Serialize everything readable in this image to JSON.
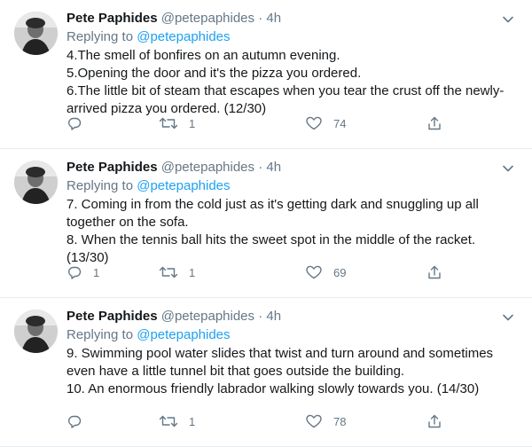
{
  "tweets": [
    {
      "name": "Pete Paphides",
      "handle": "@petepaphides",
      "time": "4h",
      "replying_prefix": "Replying to",
      "replying_to": "@petepaphides",
      "lines": [
        "4.The smell of bonfires on an autumn evening.",
        "5.Opening the door and it's the pizza you ordered.",
        "6.The little bit of steam that escapes when you tear the crust off the newly-arrived pizza you ordered.  (12/30)"
      ],
      "replies": "",
      "retweets": "1",
      "likes": "74"
    },
    {
      "name": "Pete Paphides",
      "handle": "@petepaphides",
      "time": "4h",
      "replying_prefix": "Replying to",
      "replying_to": "@petepaphides",
      "lines": [
        "7. Coming in from the cold just as it's getting dark and snuggling up all together on the sofa.",
        "8. When the tennis ball hits the sweet spot in the middle of the racket. (13/30)"
      ],
      "replies": "1",
      "retweets": "1",
      "likes": "69"
    },
    {
      "name": "Pete Paphides",
      "handle": "@petepaphides",
      "time": "4h",
      "replying_prefix": "Replying to",
      "replying_to": "@petepaphides",
      "lines": [
        "9. Swimming pool water slides that twist and turn around and sometimes even have a little tunnel bit that goes outside the building.",
        "10. An enormous friendly labrador walking slowly towards you. (14/30)"
      ],
      "replies": "",
      "retweets": "1",
      "likes": "78"
    }
  ],
  "colors": {
    "text": "#14171a",
    "muted": "#657786",
    "link": "#1da1f2",
    "divider": "#e6ecf0"
  },
  "icons": {
    "reply": "reply-icon",
    "retweet": "retweet-icon",
    "like": "heart-icon",
    "share": "share-icon",
    "caret": "chevron-down-icon"
  }
}
